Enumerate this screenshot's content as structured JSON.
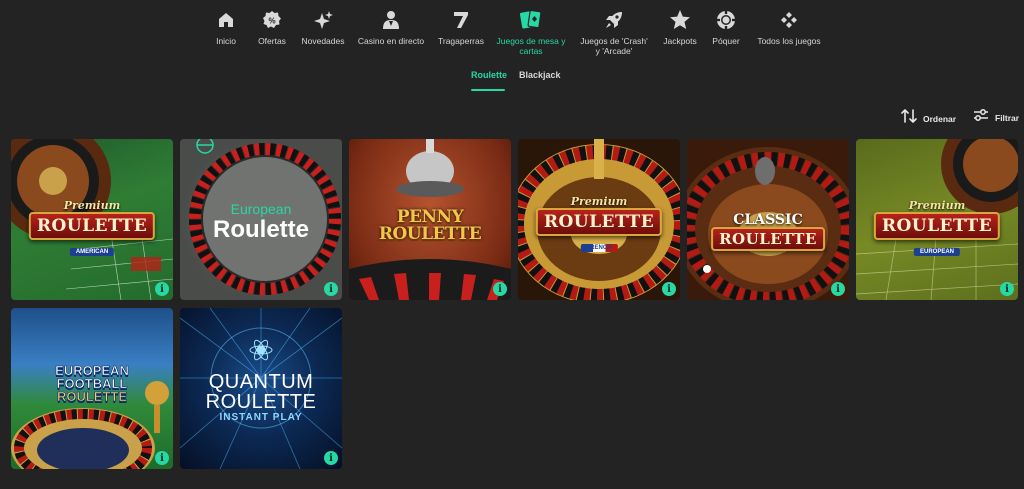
{
  "nav": {
    "items": [
      {
        "label": "Inicio",
        "icon": "home-icon"
      },
      {
        "label": "Ofertas",
        "icon": "percent-badge-icon"
      },
      {
        "label": "Novedades",
        "icon": "sparkle-icon"
      },
      {
        "label": "Casino en directo",
        "icon": "live-dealer-icon"
      },
      {
        "label": "Tragaperras",
        "icon": "slot-seven-icon"
      },
      {
        "label": "Juegos de mesa y\ncartas",
        "icon": "playing-cards-icon",
        "active": true
      },
      {
        "label": "Juegos de 'Crash'\ny 'Arcade'",
        "icon": "rocket-icon"
      },
      {
        "label": "Jackpots",
        "icon": "star-icon"
      },
      {
        "label": "Póquer",
        "icon": "poker-chip-icon"
      },
      {
        "label": "Todos los juegos",
        "icon": "diamonds-grid-icon"
      }
    ]
  },
  "subtabs": [
    {
      "label": "Roulette",
      "active": true
    },
    {
      "label": "Blackjack",
      "active": false
    }
  ],
  "toolbar": {
    "sort_label": "Ordenar",
    "filter_label": "Filtrar"
  },
  "games": [
    {
      "script": "Premium",
      "title": "ROULETTE",
      "sub": "AMERICAN"
    },
    {
      "title_line1": "European",
      "title_line2": "Roulette"
    },
    {
      "title": "PENNY ROULETTE"
    },
    {
      "script": "Premium",
      "title": "ROULETTE",
      "sub": "FRENCH"
    },
    {
      "title_line1": "CLASSIC",
      "title_line2": "ROULETTE"
    },
    {
      "script": "Premium",
      "title": "ROULETTE",
      "sub": "EUROPEAN"
    },
    {
      "title_line1": "EUROPEAN",
      "title_line2": "FOOTBALL",
      "title_line3": "ROULETTE"
    },
    {
      "title_line1": "QUANTUM",
      "title_line2": "ROULETTE",
      "sub": "INSTANT PLAY"
    }
  ],
  "info_glyph": "i",
  "colors": {
    "background": "#232323",
    "accent": "#27d7a4",
    "text": "#d6d6d6"
  }
}
